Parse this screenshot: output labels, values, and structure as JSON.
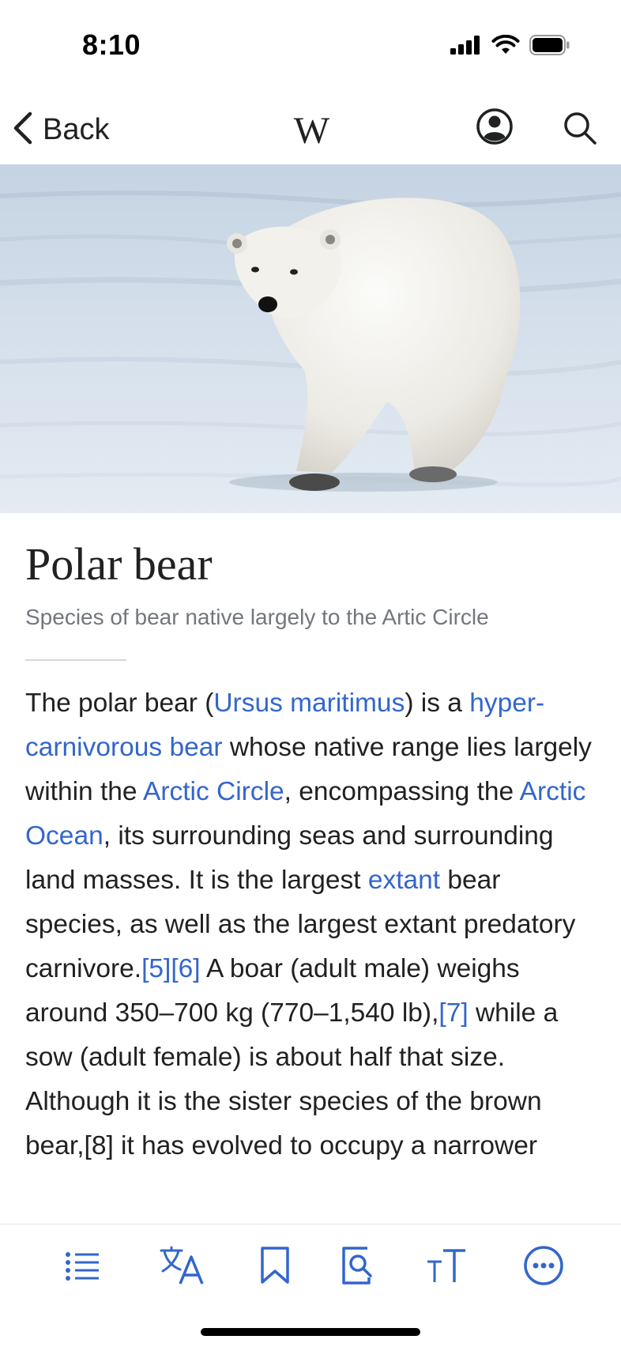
{
  "status_bar": {
    "time": "8:10"
  },
  "nav": {
    "back_label": "Back",
    "logo": "W"
  },
  "article": {
    "title": "Polar bear",
    "subtitle": "Species of bear native largely to the Artic Circle",
    "body": {
      "t1": "The polar bear (",
      "l1": "Ursus maritimus",
      "t2": ") is a ",
      "l2": "hyper-carnivorous bear",
      "t3": " whose native range lies largely within the ",
      "l3": "Arctic Circle",
      "t4": ", encompassing the ",
      "l4": "Arctic Ocean",
      "t5": ", its surrounding seas and surrounding land masses. It is the largest ",
      "l5": "extant",
      "t6": " bear species, as well as the largest extant predatory carnivore.",
      "r1": "[5]",
      "r2": "[6]",
      "t7": " A boar (adult male) weighs around 350–700 kg (770–1,540 lb),",
      "r3": "[7]",
      "t8": " while a sow (adult female) is about half that size. Although it is the sister species of the brown bear,[8] it has evolved to occupy a narrower"
    }
  },
  "colors": {
    "link": "#3366cc",
    "text": "#202122",
    "subtitle": "#72777d"
  },
  "toolbar": {
    "icons": [
      "table-of-contents-icon",
      "language-icon",
      "bookmark-icon",
      "find-in-page-icon",
      "text-size-icon",
      "more-icon"
    ]
  }
}
